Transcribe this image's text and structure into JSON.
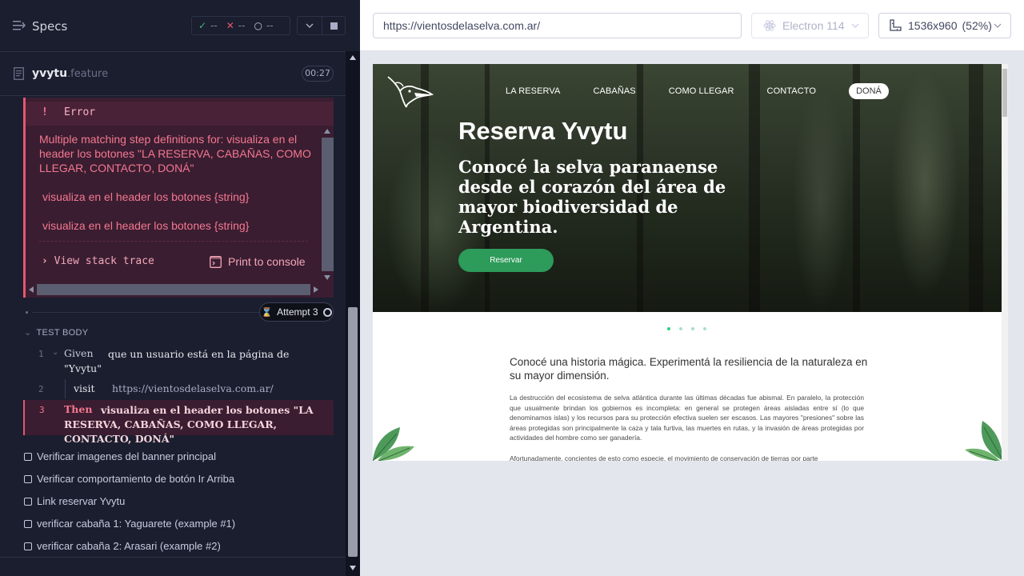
{
  "sidebar": {
    "title": "Specs",
    "stats": {
      "passed": "--",
      "failed": "--",
      "pending": "--"
    }
  },
  "file": {
    "name": "yvytu",
    "ext": ".feature",
    "duration": "00:27"
  },
  "error": {
    "bang": "!",
    "title": "Error",
    "message": "Multiple matching step definitions for: visualiza en el header los botones \"LA RESERVA, CABAÑAS, COMO LLEGAR, CONTACTO, DONÁ\"",
    "match1": "visualiza en el header los botones {string}",
    "match2": "visualiza en el header los botones {string}",
    "stack_trace": "View stack trace",
    "print_console": "Print to console"
  },
  "attempt": "Attempt 3",
  "test_body": {
    "label": "TEST BODY",
    "commands": [
      {
        "num": "1",
        "kw": "Given",
        "text": "que un usuario está en la página de \"Yvytu\""
      },
      {
        "num": "2",
        "kw": "visit",
        "text": "https://vientosdelaselva.com.ar/"
      },
      {
        "num": "3",
        "kw": "Then",
        "text": "visualiza en el header los botones \"LA RESERVA, CABAÑAS, COMO LLEGAR, CONTACTO, DONÁ\""
      }
    ]
  },
  "tests": [
    "Verificar imagenes del banner principal",
    "Verificar comportamiento de botón Ir Arriba",
    "Link reservar Yvytu",
    "verificar cabaña 1: Yaguarete (example #1)",
    "verificar cabaña 2: Arasari (example #2)"
  ],
  "browser_bar": {
    "url": "https://vientosdelaselva.com.ar/",
    "browser": "Electron 114",
    "viewport": "1536x960",
    "zoom": "(52%)"
  },
  "site": {
    "nav": [
      "LA RESERVA",
      "CABAÑAS",
      "COMO LLEGAR",
      "CONTACTO"
    ],
    "nav_dona": "DONÁ",
    "hero_title": "Reserva Yvytu",
    "hero_sub": "Conocé la selva paranaense desde el corazón del área de mayor biodiversidad de Argentina.",
    "hero_button": "Reservar",
    "intro": "Conocé una historia mágica. Experimentá la resiliencia de la naturaleza en su mayor dimensión.",
    "para1": "La destrucción del ecosistema de selva atlántica durante las últimas décadas fue abismal. En paralelo, la protección que usualmente brindan los gobiernos es incompleta: en general se protegen áreas aisladas entre sí (lo que denominamos islas) y los recursos para su protección efectiva suelen ser escasos. Las mayores \"presiones\" sobre las áreas protegidas son principalmente la caza y tala furtiva, las muertes en rutas, y la invasión de áreas protegidas por actividades del hombre como ser ganadería.",
    "para2": "Afortunadamente, concientes de esto como especie, el movimiento de conservación de tierras por parte"
  },
  "colors": {
    "accent_error": "#e45770",
    "pass": "#3fb27f",
    "reservar": "#2d9b5a"
  }
}
